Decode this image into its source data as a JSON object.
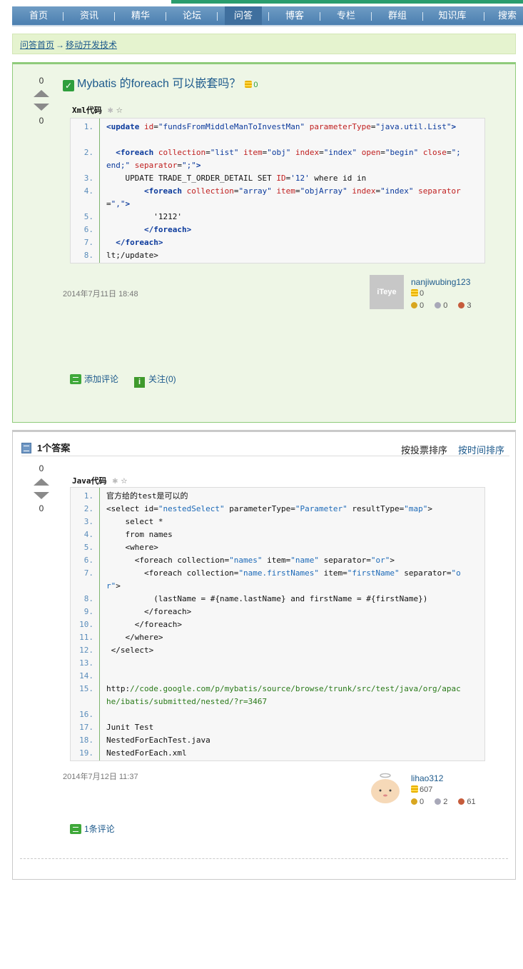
{
  "nav": {
    "items": [
      "首页",
      "资讯",
      "精华",
      "论坛",
      "问答",
      "博客",
      "专栏",
      "群组",
      "知识库",
      "搜索"
    ],
    "active": "问答"
  },
  "breadcrumb": {
    "home": "问答首页",
    "arrow": "→",
    "category": "移动开发技术"
  },
  "question": {
    "votes_up": "0",
    "votes_down": "0",
    "title": "Mybatis 的foreach 可以嵌套吗？",
    "bounty": "0",
    "code_lang": "Xml代码",
    "code_lines": [
      {
        "n": "1.",
        "html": "<span class=\"tag\">&lt;update</span> <span class=\"attr\">id</span>=<span class=\"val\">\"fundsFromMiddleManToInvestMan\"</span> <span class=\"attr\">parameterType</span>=<span class=\"val\">\"java.util.List\"</span><span class=\"tag\">&gt;</span>"
      },
      {
        "n": "",
        "html": ""
      },
      {
        "n": "2.",
        "html": "  <span class=\"tag\">&lt;foreach</span> <span class=\"attr\">collection</span>=<span class=\"val\">\"list\"</span> <span class=\"attr\">item</span>=<span class=\"val\">\"obj\"</span> <span class=\"attr\">index</span>=<span class=\"val\">\"index\"</span> <span class=\"attr\">open</span>=<span class=\"val\">\"begin\"</span> <span class=\"attr\">close</span>=<span class=\"val\">\";</span>"
      },
      {
        "n": "",
        "html": "<span class=\"val\">end;\"</span> <span class=\"attr\">separator</span>=<span class=\"val\">\";\"</span><span class=\"tag\">&gt;</span>"
      },
      {
        "n": "3.",
        "html": "    UPDATE TRADE_T_ORDER_DETAIL SET <span class=\"attr\">ID</span>=<span class=\"val\">'12'</span> where id in"
      },
      {
        "n": "4.",
        "html": "        <span class=\"tag\">&lt;foreach</span> <span class=\"attr\">collection</span>=<span class=\"val\">\"array\"</span> <span class=\"attr\">item</span>=<span class=\"val\">\"objArray\"</span> <span class=\"attr\">index</span>=<span class=\"val\">\"index\"</span> <span class=\"attr\">separator</span>"
      },
      {
        "n": "",
        "html": "=<span class=\"val\">\",\"</span><span class=\"tag\">&gt;</span>"
      },
      {
        "n": "5.",
        "html": "          '1212'"
      },
      {
        "n": "6.",
        "html": "        <span class=\"tag\">&lt;/foreach&gt;</span>"
      },
      {
        "n": "7.",
        "html": "  <span class=\"tag\">&lt;/foreach&gt;</span>"
      },
      {
        "n": "8.",
        "html": "lt;/update&gt;"
      }
    ],
    "date": "2014年7月11日 18:48",
    "user": {
      "avatar_text": "iTeye",
      "name": "nanjiwubing123",
      "score": "0",
      "gold": "0",
      "silver": "0",
      "bronze": "3"
    },
    "add_comment": "添加评论",
    "follow": "关注(0)"
  },
  "answers": {
    "count_label": "1个答案",
    "sort_by_votes": "按投票排序",
    "sort_by_time": "按时间排序",
    "items": [
      {
        "votes_up": "0",
        "votes_down": "0",
        "code_lang": "Java代码",
        "code_lines": [
          {
            "n": "1.",
            "html": "官方给的test是可以的"
          },
          {
            "n": "2.",
            "html": "&lt;select id=<span class=\"str\">\"nestedSelect\"</span> parameterType=<span class=\"str\">\"Parameter\"</span> resultType=<span class=\"str\">\"map\"</span>&gt;"
          },
          {
            "n": "3.",
            "html": "    select *"
          },
          {
            "n": "4.",
            "html": "    from names"
          },
          {
            "n": "5.",
            "html": "    &lt;where&gt;"
          },
          {
            "n": "6.",
            "html": "      &lt;foreach collection=<span class=\"str\">\"names\"</span> item=<span class=\"str\">\"name\"</span> separator=<span class=\"str\">\"or\"</span>&gt;"
          },
          {
            "n": "7.",
            "html": "        &lt;foreach collection=<span class=\"str\">\"name.firstNames\"</span> item=<span class=\"str\">\"firstName\"</span> separator=<span class=\"str\">\"o</span>"
          },
          {
            "n": "",
            "html": "<span class=\"str\">r\"</span>&gt;"
          },
          {
            "n": "8.",
            "html": "          (lastName = #{name.lastName} and firstName = #{firstName})"
          },
          {
            "n": "9.",
            "html": "        &lt;/foreach&gt;"
          },
          {
            "n": "10.",
            "html": "      &lt;/foreach&gt;"
          },
          {
            "n": "11.",
            "html": "    &lt;/where&gt;"
          },
          {
            "n": "12.",
            "html": " &lt;/select&gt;"
          },
          {
            "n": "13.",
            "html": ""
          },
          {
            "n": "14.",
            "html": ""
          },
          {
            "n": "15.",
            "html": "http:<span class=\"url\">//code.google.com/p/mybatis/source/browse/trunk/src/test/java/org/apac</span>"
          },
          {
            "n": "",
            "html": "<span class=\"url\">he/ibatis/submitted/nested/?r=3467</span>"
          },
          {
            "n": "16.",
            "html": ""
          },
          {
            "n": "17.",
            "html": "Junit Test"
          },
          {
            "n": "18.",
            "html": "NestedForEachTest.java"
          },
          {
            "n": "19.",
            "html": "NestedForEach.xml"
          }
        ],
        "date": "2014年7月12日 11:37",
        "user": {
          "name": "lihao312",
          "score": "607",
          "gold": "0",
          "silver": "2",
          "bronze": "61"
        },
        "comments_link": "1条评论"
      }
    ]
  },
  "colors": {
    "nav": "#4b7fb0",
    "nav_active": "#3f6f9e",
    "question_bg": "#eef6e6",
    "question_border": "#8fcb7b",
    "link": "#1d5a8c"
  }
}
